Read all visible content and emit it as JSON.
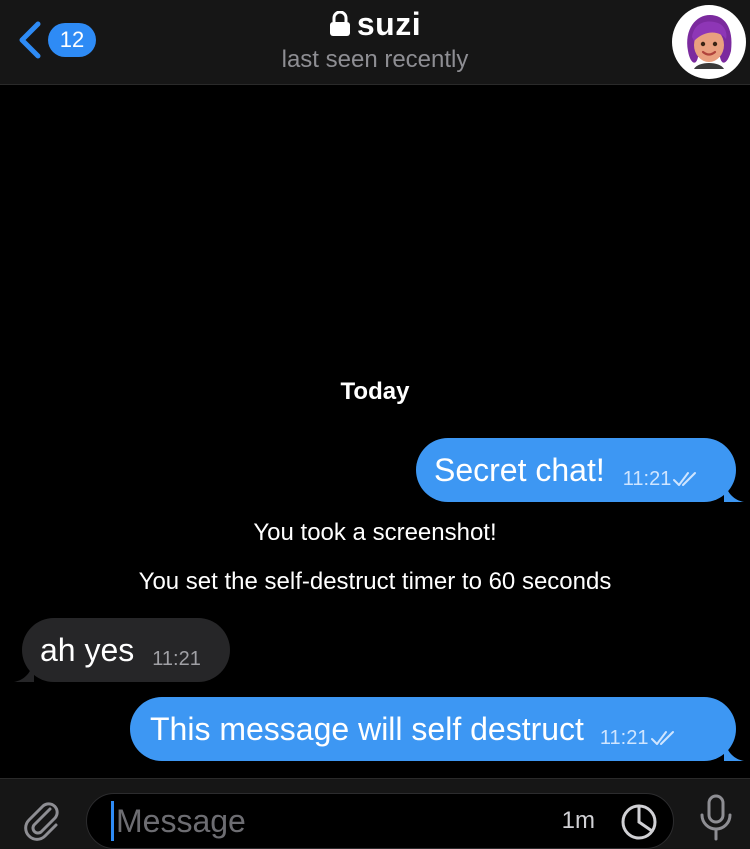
{
  "header": {
    "back_badge": "12",
    "title": "suzi",
    "status": "last seen recently",
    "avatar_icon": "avatar-icon"
  },
  "chat": {
    "date_label": "Today",
    "messages": [
      {
        "type": "outgoing",
        "text": "Secret chat!",
        "time": "11:21",
        "read": true
      },
      {
        "type": "service",
        "text": "You took a screenshot!"
      },
      {
        "type": "service",
        "text": "You set the self-destruct timer to 60 seconds"
      },
      {
        "type": "incoming",
        "text": "ah yes",
        "time": "11:21"
      },
      {
        "type": "outgoing",
        "text": "This message will self destruct",
        "time": "11:21",
        "read": true
      }
    ]
  },
  "input": {
    "placeholder": "Message",
    "timer_label": "1m"
  },
  "colors": {
    "accent": "#2e8bf5",
    "outgoing_bubble": "#3d97f3",
    "incoming_bubble": "#262628",
    "bar_background": "#161616"
  }
}
